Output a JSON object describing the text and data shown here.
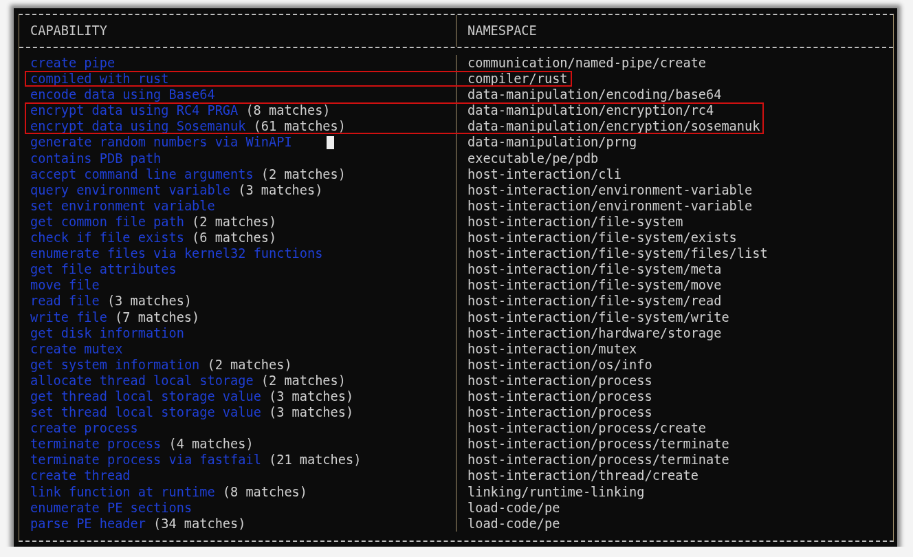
{
  "table": {
    "columns": [
      "CAPABILITY",
      "NAMESPACE"
    ],
    "rows": [
      {
        "capability": "create pipe",
        "namespace": "communication/named-pipe/create",
        "highlighted": false,
        "cursor": false
      },
      {
        "capability": "compiled with rust",
        "namespace": "compiler/rust",
        "highlighted": true,
        "cursor": false
      },
      {
        "capability": "encode data using Base64",
        "namespace": "data-manipulation/encoding/base64",
        "highlighted": false,
        "cursor": false
      },
      {
        "capability": "encrypt data using RC4 PRGA",
        "matches": "(8 matches)",
        "namespace": "data-manipulation/encryption/rc4",
        "highlighted": true,
        "cursor": false
      },
      {
        "capability": "encrypt data using Sosemanuk",
        "matches": "(61 matches)",
        "namespace": "data-manipulation/encryption/sosemanuk",
        "highlighted": true,
        "cursor": false
      },
      {
        "capability": "generate random numbers via WinAPI",
        "namespace": "data-manipulation/prng",
        "highlighted": false,
        "cursor": true
      },
      {
        "capability": "contains PDB path",
        "namespace": "executable/pe/pdb",
        "highlighted": false,
        "cursor": false
      },
      {
        "capability": "accept command line arguments",
        "matches": "(2 matches)",
        "namespace": "host-interaction/cli",
        "highlighted": false,
        "cursor": false
      },
      {
        "capability": "query environment variable",
        "matches": "(3 matches)",
        "namespace": "host-interaction/environment-variable",
        "highlighted": false,
        "cursor": false
      },
      {
        "capability": "set environment variable",
        "namespace": "host-interaction/environment-variable",
        "highlighted": false,
        "cursor": false
      },
      {
        "capability": "get common file path",
        "matches": "(2 matches)",
        "namespace": "host-interaction/file-system",
        "highlighted": false,
        "cursor": false
      },
      {
        "capability": "check if file exists",
        "matches": "(6 matches)",
        "namespace": "host-interaction/file-system/exists",
        "highlighted": false,
        "cursor": false
      },
      {
        "capability": "enumerate files via kernel32 functions",
        "namespace": "host-interaction/file-system/files/list",
        "highlighted": false,
        "cursor": false
      },
      {
        "capability": "get file attributes",
        "namespace": "host-interaction/file-system/meta",
        "highlighted": false,
        "cursor": false
      },
      {
        "capability": "move file",
        "namespace": "host-interaction/file-system/move",
        "highlighted": false,
        "cursor": false
      },
      {
        "capability": "read file",
        "matches": "(3 matches)",
        "namespace": "host-interaction/file-system/read",
        "highlighted": false,
        "cursor": false
      },
      {
        "capability": "write file",
        "matches": "(7 matches)",
        "namespace": "host-interaction/file-system/write",
        "highlighted": false,
        "cursor": false
      },
      {
        "capability": "get disk information",
        "namespace": "host-interaction/hardware/storage",
        "highlighted": false,
        "cursor": false
      },
      {
        "capability": "create mutex",
        "namespace": "host-interaction/mutex",
        "highlighted": false,
        "cursor": false
      },
      {
        "capability": "get system information",
        "matches": "(2 matches)",
        "namespace": "host-interaction/os/info",
        "highlighted": false,
        "cursor": false
      },
      {
        "capability": "allocate thread local storage",
        "matches": "(2 matches)",
        "namespace": "host-interaction/process",
        "highlighted": false,
        "cursor": false
      },
      {
        "capability": "get thread local storage value",
        "matches": "(3 matches)",
        "namespace": "host-interaction/process",
        "highlighted": false,
        "cursor": false
      },
      {
        "capability": "set thread local storage value",
        "matches": "(3 matches)",
        "namespace": "host-interaction/process",
        "highlighted": false,
        "cursor": false
      },
      {
        "capability": "create process",
        "namespace": "host-interaction/process/create",
        "highlighted": false,
        "cursor": false
      },
      {
        "capability": "terminate process",
        "matches": "(4 matches)",
        "namespace": "host-interaction/process/terminate",
        "highlighted": false,
        "cursor": false
      },
      {
        "capability": "terminate process via fastfail",
        "matches": "(21 matches)",
        "namespace": "host-interaction/process/terminate",
        "highlighted": false,
        "cursor": false
      },
      {
        "capability": "create thread",
        "namespace": "host-interaction/thread/create",
        "highlighted": false,
        "cursor": false
      },
      {
        "capability": "link function at runtime",
        "matches": "(8 matches)",
        "namespace": "linking/runtime-linking",
        "highlighted": false,
        "cursor": false
      },
      {
        "capability": "enumerate PE sections",
        "namespace": "load-code/pe",
        "highlighted": false,
        "cursor": false
      },
      {
        "capability": "parse PE header",
        "matches": "(34 matches)",
        "namespace": "load-code/pe",
        "highlighted": false,
        "cursor": false
      }
    ]
  }
}
